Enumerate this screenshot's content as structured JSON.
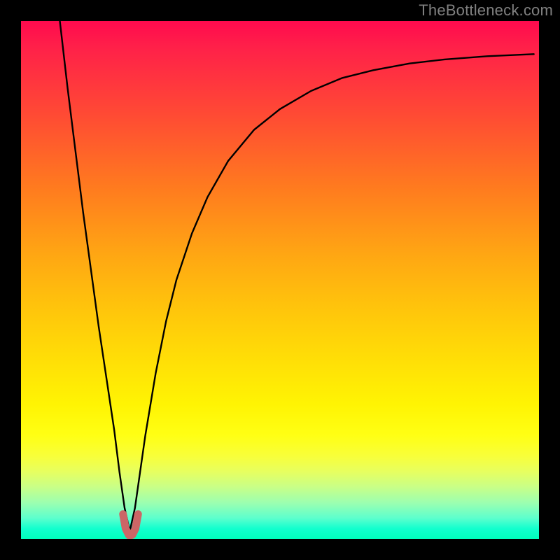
{
  "watermark": "TheBottleneck.com",
  "chart_data": {
    "type": "line",
    "title": "",
    "xlabel": "",
    "ylabel": "",
    "xlim": [
      0,
      100
    ],
    "ylim": [
      0,
      100
    ],
    "grid": false,
    "notes": "Background heat gradient runs from red (top, high bottleneck) to green (bottom, no bottleneck). The black curve has a sharp minimum near x≈21; a short pink/red segment marks the bottom of the dip at y≈1.",
    "series": [
      {
        "name": "bottleneck-curve",
        "color": "#000000",
        "x": [
          7.5,
          9,
          10.5,
          12,
          13.5,
          15,
          16.5,
          18,
          19,
          20,
          21,
          22,
          23,
          24,
          26,
          28,
          30,
          33,
          36,
          40,
          45,
          50,
          56,
          62,
          68,
          75,
          82,
          90,
          99
        ],
        "y": [
          100,
          87,
          75,
          63,
          52,
          41,
          31,
          21,
          13,
          6,
          1.5,
          6,
          13,
          20,
          32,
          42,
          50,
          59,
          66,
          73,
          79,
          83,
          86.5,
          89,
          90.5,
          91.8,
          92.6,
          93.2,
          93.6
        ]
      },
      {
        "name": "minimum-marker",
        "color": "#cc6666",
        "x": [
          19.7,
          20.2,
          20.8,
          21.0,
          21.5,
          22.1,
          22.6
        ],
        "y": [
          4.8,
          2.0,
          0.8,
          0.6,
          0.8,
          2.0,
          4.8
        ]
      }
    ]
  }
}
